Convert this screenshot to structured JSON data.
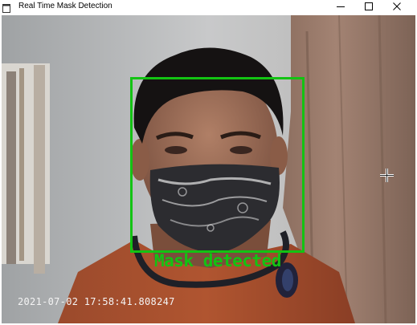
{
  "window": {
    "title": "Real Time Mask Detection",
    "controls": [
      "minimize",
      "maximize",
      "close"
    ]
  },
  "overlay": {
    "label": "Mask detected",
    "color": "#13c313"
  },
  "timestamp": "2021-07-02 17:58:41.808247",
  "icons": {
    "app": "app-window-icon",
    "minimize": "minimize-icon",
    "maximize": "maximize-icon",
    "close": "close-icon",
    "cursor": "crosshair-cursor-icon"
  }
}
